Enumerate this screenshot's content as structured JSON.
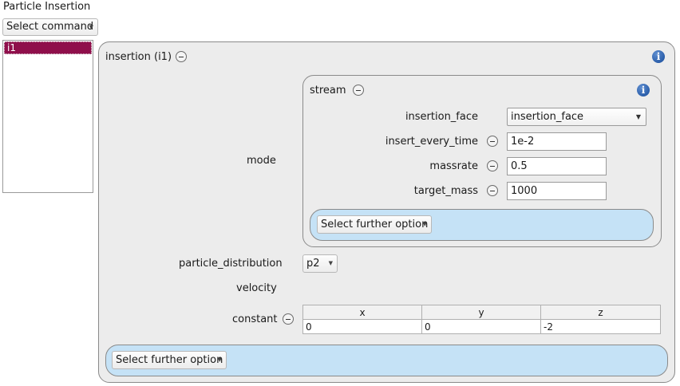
{
  "title": "Particle Insertion",
  "select_command": "Select command",
  "list": {
    "items": [
      "i1"
    ]
  },
  "insertion_panel": {
    "title": "insertion (i1)",
    "mode_label": "mode",
    "stream": {
      "title": "stream",
      "fields": {
        "insertion_face": {
          "label": "insertion_face",
          "value": "insertion_face"
        },
        "insert_every_time": {
          "label": "insert_every_time",
          "value": "1e-2"
        },
        "massrate": {
          "label": "massrate",
          "value": "0.5"
        },
        "target_mass": {
          "label": "target_mass",
          "value": "1000"
        }
      },
      "further_option": "Select further option"
    },
    "particle_distribution": {
      "label": "particle_distribution",
      "value": "p2"
    },
    "velocity_label": "velocity",
    "constant": {
      "label": "constant",
      "columns": [
        "x",
        "y",
        "z"
      ],
      "values": [
        "0",
        "0",
        "-2"
      ]
    },
    "further_option": "Select further option"
  },
  "colors": {
    "selected_item": "#8f0f4b",
    "option_area": "#c5e2f6",
    "panel": "#ececec"
  }
}
